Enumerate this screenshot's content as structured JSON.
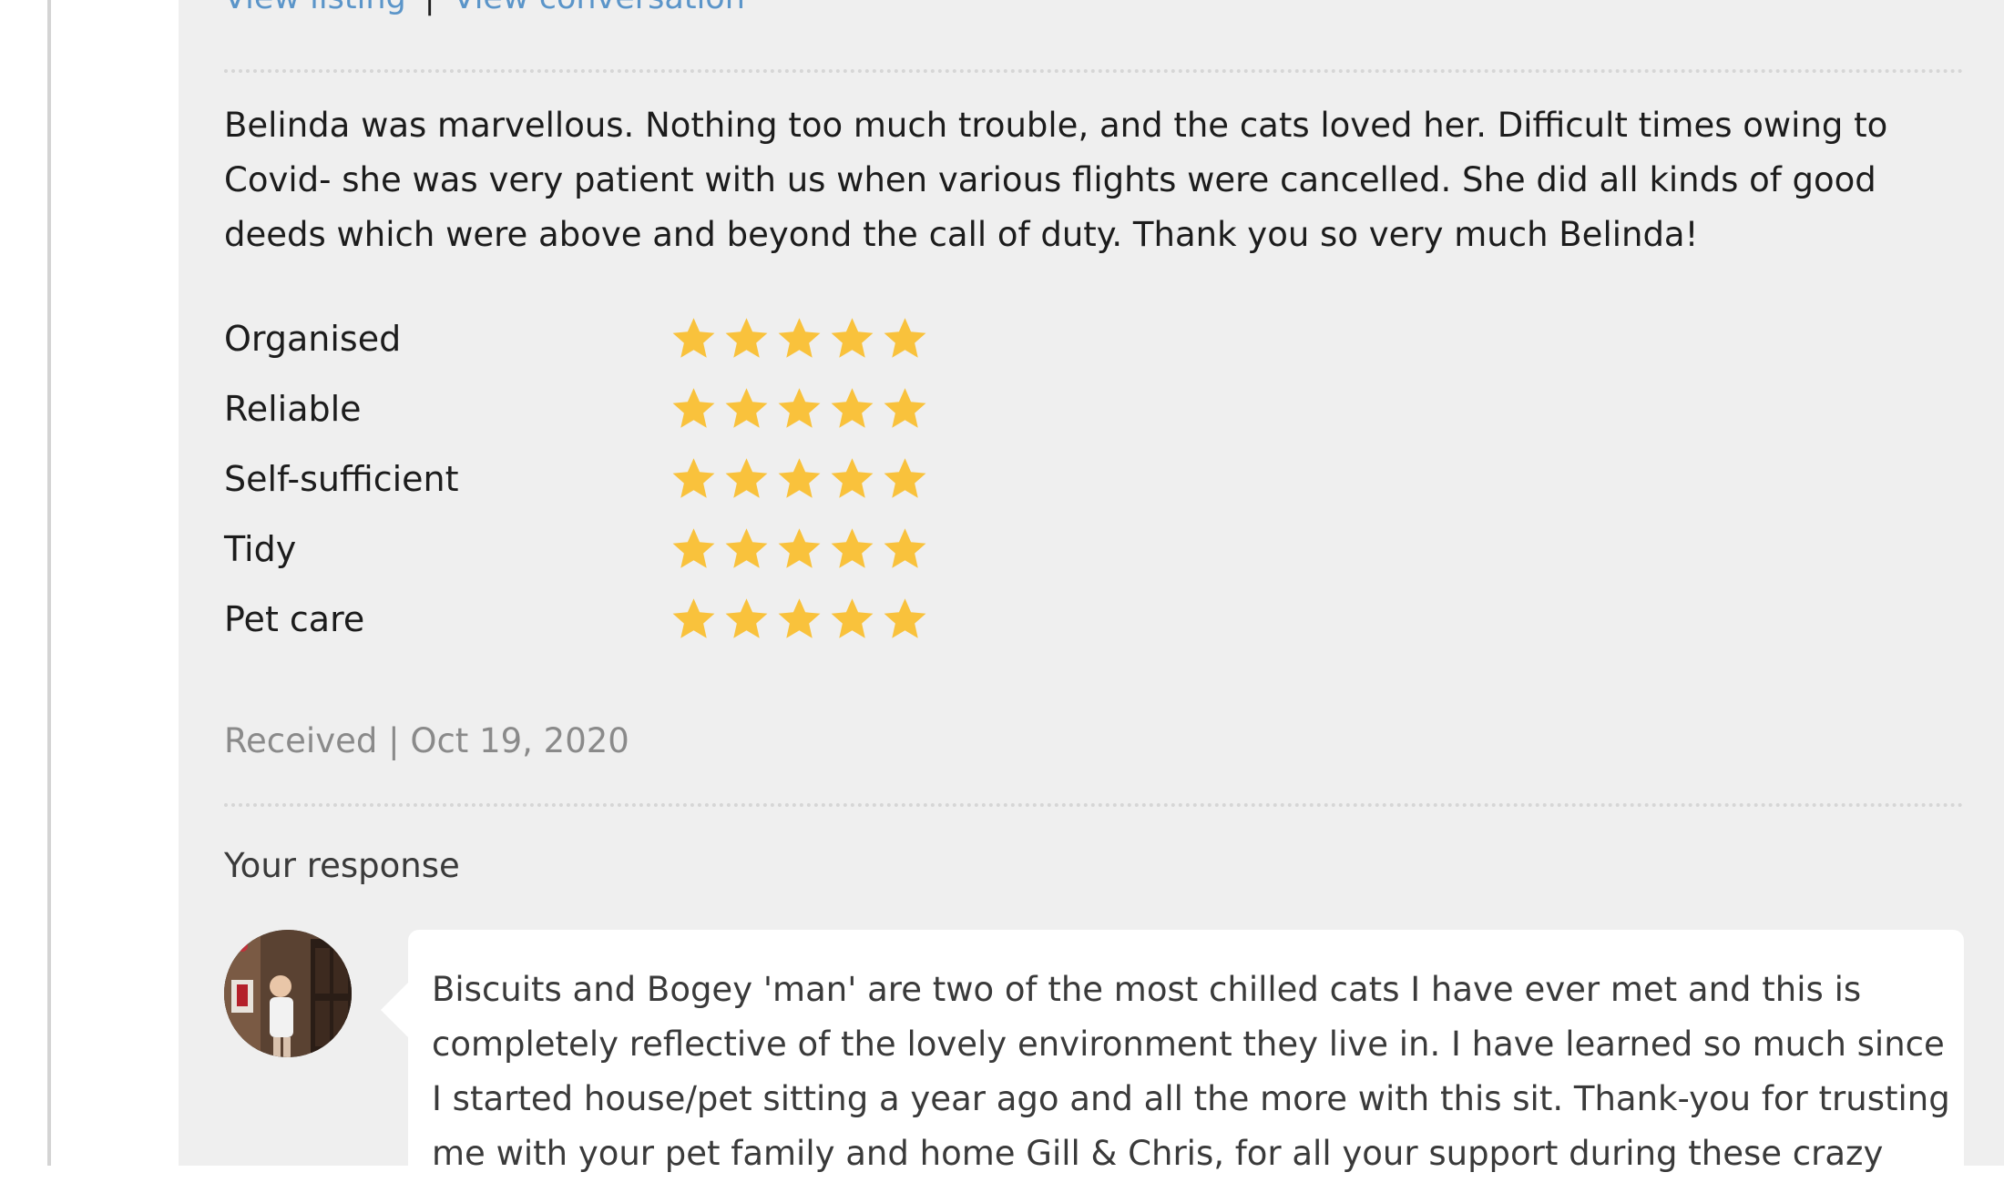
{
  "links": {
    "view_listing": "View listing",
    "separator": "|",
    "view_conversation": "View conversation"
  },
  "review": {
    "text": "Belinda was marvellous. Nothing too much trouble, and the cats loved her. Difficult times owing to Covid- she was very patient with us when various flights were cancelled. She did all kinds of good deeds which were above and beyond the call of duty. Thank you so very much Belinda!"
  },
  "ratings": [
    {
      "label": "Organised",
      "stars": 5,
      "max": 5
    },
    {
      "label": "Reliable",
      "stars": 5,
      "max": 5
    },
    {
      "label": "Self-sufficient",
      "stars": 5,
      "max": 5
    },
    {
      "label": "Tidy",
      "stars": 5,
      "max": 5
    },
    {
      "label": "Pet care",
      "stars": 5,
      "max": 5
    }
  ],
  "received": "Received | Oct 19, 2020",
  "response": {
    "heading": "Your response",
    "text": "Biscuits and Bogey 'man' are two of the most chilled cats I have ever met and this is completely reflective of the lovely environment they live in. I have learned so much since I started house/pet sitting a year ago and all the more with this sit. Thank-you for trusting me with your pet family and home Gill & Chris, for all your support during these crazy"
  },
  "colors": {
    "star": "#f9c23c",
    "link": "#5b95c9",
    "card_bg": "#efefef"
  },
  "icons": {
    "star": "star-icon",
    "avatar": "avatar"
  }
}
